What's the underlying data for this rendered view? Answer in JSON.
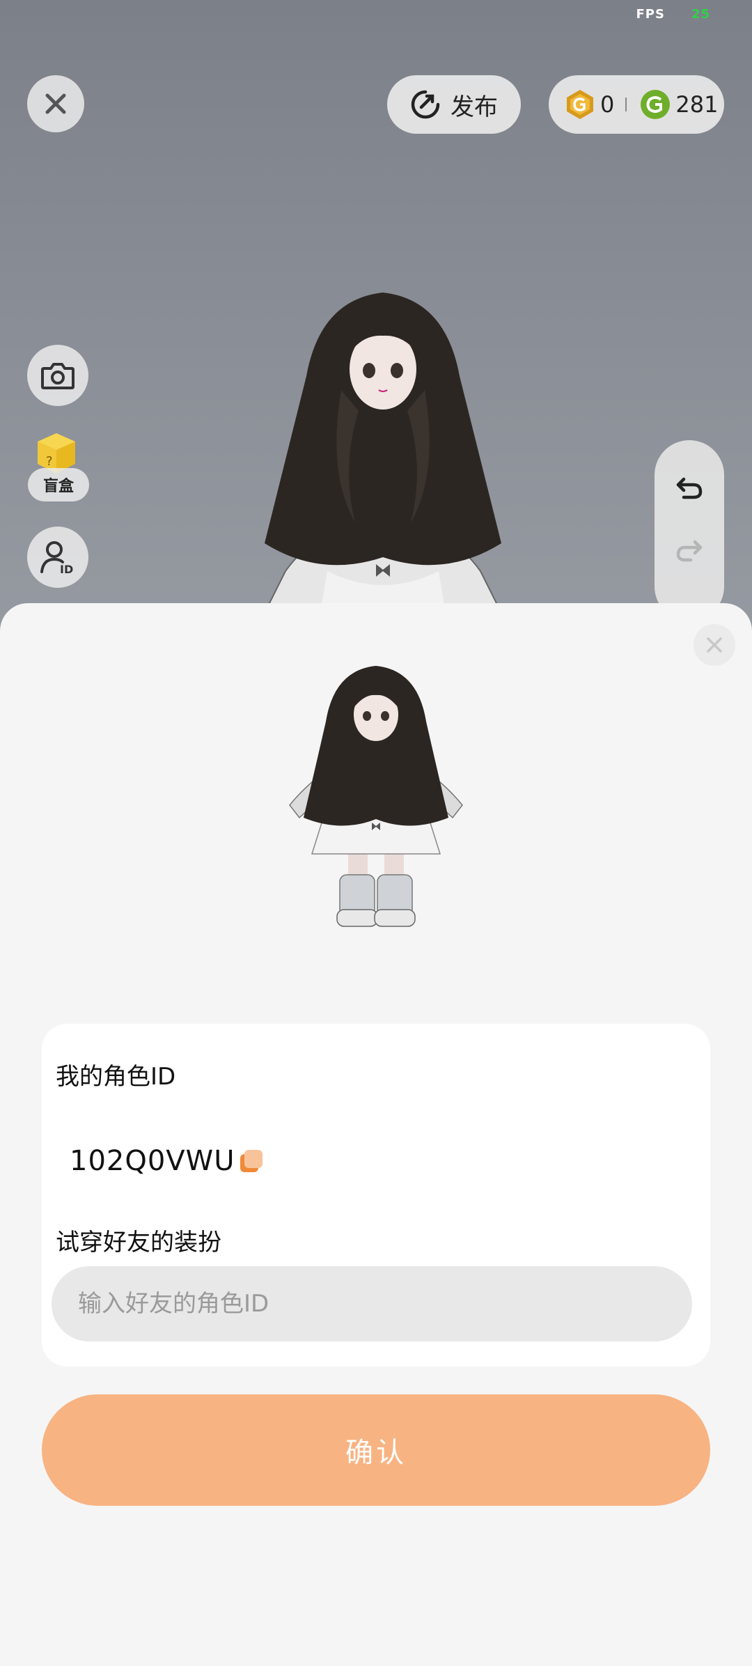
{
  "hud": {
    "fps_label": "FPS",
    "fps_value": "25"
  },
  "top_bar": {
    "publish_label": "发布",
    "currency_a": {
      "icon": "gold-coin-icon",
      "value": "0",
      "color": "#d79a1a"
    },
    "currency_b": {
      "icon": "green-coin-icon",
      "value": "281",
      "color": "#6fae2a"
    }
  },
  "side_tools": {
    "blind_box_label": "盲盒"
  },
  "sheet": {
    "my_id_label": "我的角色ID",
    "my_id_value": "102Q0VWU",
    "try_on_label": "试穿好友的装扮",
    "friend_id_placeholder": "输入好友的角色ID",
    "friend_id_value": "",
    "confirm_label": "确认"
  },
  "colors": {
    "accent": "#f8b382",
    "sheet_bg": "#f5f5f5",
    "fps_good": "#2fd14a"
  }
}
